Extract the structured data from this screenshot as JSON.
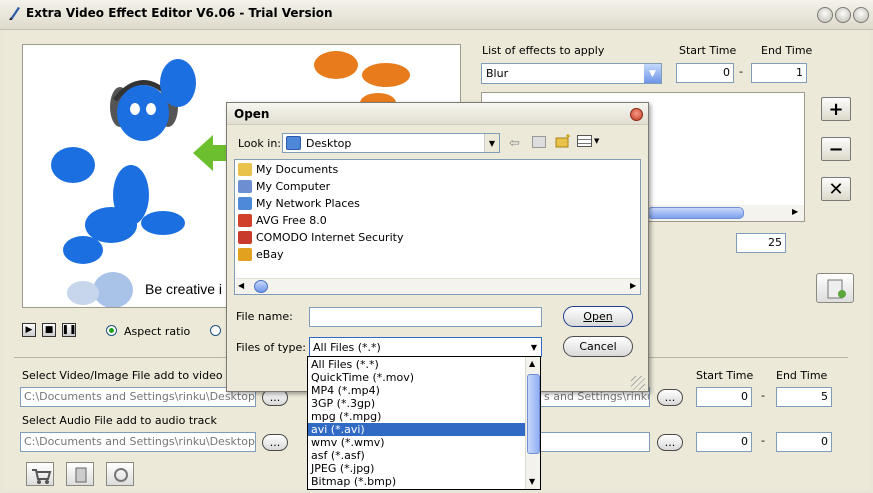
{
  "window": {
    "title": "Extra Video Effect Editor V6.06 - Trial Version"
  },
  "preview": {
    "caption": "Be creative i"
  },
  "playback": {
    "aspect_ratio_label": "Aspect ratio"
  },
  "effects": {
    "list_label": "List of effects to apply",
    "start_time_label": "Start Time",
    "end_time_label": "End Time",
    "selected_effect": "Blur",
    "start_time_value": "0",
    "end_time_value": "1",
    "separator": "-",
    "level_value": "25"
  },
  "video_track": {
    "label": "Select Video/Image File add to video track",
    "path": "C:\\Documents and Settings\\rinku\\Desktop\\die.",
    "path2": "s and Settings\\rinku\\De",
    "start_time_label": "Start Time",
    "end_time_label": "End Time",
    "start_value": "0",
    "end_value": "5",
    "browse_label": "..."
  },
  "audio_track": {
    "label": "Select Audio File add to audio track",
    "path": "C:\\Documents and Settings\\rinku\\Desktop\\ATg",
    "start_value": "0",
    "end_value": "0",
    "browse_label": "..."
  },
  "dialog": {
    "title": "Open",
    "look_in_label": "Look in:",
    "look_in_value": "Desktop",
    "items": [
      {
        "name": "My Documents",
        "icon": "folder-documents-icon",
        "color": "#e8c24a"
      },
      {
        "name": "My Computer",
        "icon": "computer-icon",
        "color": "#6b8fd0"
      },
      {
        "name": "My Network Places",
        "icon": "network-icon",
        "color": "#4d89d8"
      },
      {
        "name": "AVG Free 8.0",
        "icon": "shortcut-icon",
        "color": "#d0402a"
      },
      {
        "name": "COMODO Internet Security",
        "icon": "shortcut-icon",
        "color": "#c83a2b"
      },
      {
        "name": "eBay",
        "icon": "shortcut-icon",
        "color": "#e2a21f"
      }
    ],
    "file_name_label": "File name:",
    "file_name_value": "",
    "files_of_type_label": "Files of type:",
    "files_of_type_value": "All Files (*.*)",
    "open_button": "Open",
    "cancel_button": "Cancel",
    "type_options": [
      "All Files (*.*)",
      "QuickTime (*.mov)",
      "MP4 (*.mp4)",
      "3GP (*.3gp)",
      "mpg (*.mpg)",
      "avi (*.avi)",
      "wmv (*.wmv)",
      "asf (*.asf)",
      "JPEG (*.jpg)",
      "Bitmap (*.bmp)"
    ],
    "selected_option_index": 5
  },
  "colors": {
    "selection": "#316ac5",
    "window_bg": "#ece9d8"
  }
}
